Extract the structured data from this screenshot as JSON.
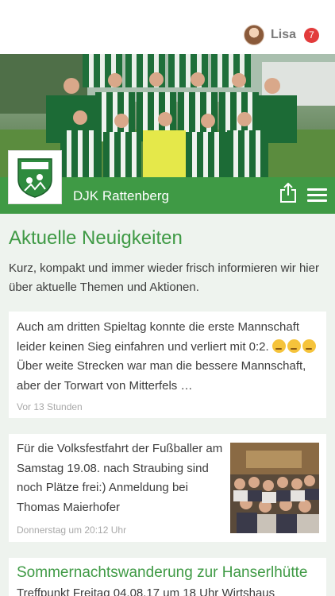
{
  "header": {
    "username": "Lisa",
    "notification_count": "7"
  },
  "club": {
    "name": "DJK Rattenberg",
    "logo_text": "DJK RATTENBERG E.V."
  },
  "news": {
    "title": "Aktuelle Neuigkeiten",
    "intro": "Kurz, kompakt und immer wieder frisch informieren wir hier über aktuelle Themen und Aktionen.",
    "items": [
      {
        "text_before": "Auch am dritten Spieltag konnte die erste Mannschaft leider keinen Sieg einfahren und verliert mit 0:2.",
        "text_after": "Über weite Strecken war man die bessere Mannschaft, aber der Torwart von Mitterfels …",
        "time": "Vor 13 Stunden"
      },
      {
        "text": "Für die Volksfestfahrt der Fußballer am Samstag 19.08. nach Straubing sind noch Plätze frei:) Anmeldung bei Thomas Maierhofer",
        "time": "Donnerstag um 20:12 Uhr"
      },
      {
        "title": "Sommernachtswanderung zur Hanserlhütte",
        "text": "Treffpunkt Freitag 04.08.17 um 18 Uhr Wirtshaus"
      }
    ]
  },
  "colors": {
    "brand_green": "#3f9a45",
    "badge_red": "#e23b3b",
    "background": "#eef3ee"
  }
}
